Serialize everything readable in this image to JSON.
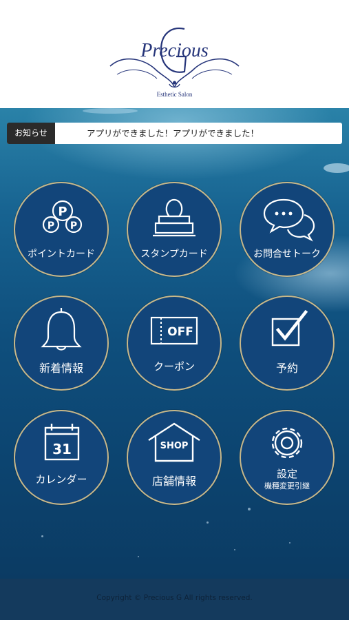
{
  "header": {
    "logo": {
      "name": "Precious",
      "monogram": "G",
      "subtitle": "Esthetic Salon"
    }
  },
  "news": {
    "label": "お知らせ",
    "text": "アプリができました！アプリができました！"
  },
  "menu": [
    {
      "label": "ポイントカード",
      "icon": "point-card-icon"
    },
    {
      "label": "スタンプカード",
      "icon": "stamp-icon"
    },
    {
      "label": "お問合せトーク",
      "icon": "chat-bubbles-icon"
    },
    {
      "label": "新着情報",
      "icon": "bell-icon"
    },
    {
      "label": "クーポン",
      "icon": "coupon-icon",
      "icon_text": "OFF"
    },
    {
      "label": "予約",
      "icon": "checkbox-icon"
    },
    {
      "label": "カレンダー",
      "icon": "calendar-icon",
      "icon_text": "31"
    },
    {
      "label": "店舗情報",
      "icon": "shop-icon",
      "icon_text": "SHOP"
    },
    {
      "label": "設定",
      "sublabel": "機種変更引継",
      "icon": "gear-icon"
    }
  ],
  "footer": {
    "copyright": "Copyright © Precious G All rights reserved."
  },
  "colors": {
    "accent_ring": "#c8b88a",
    "tile_fill": "#12457a",
    "logo": "#26357a"
  }
}
